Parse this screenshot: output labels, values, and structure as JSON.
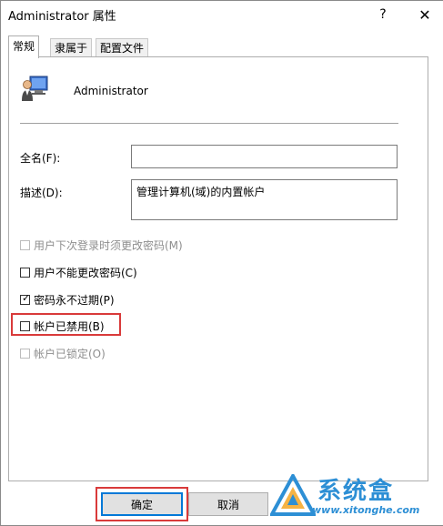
{
  "window": {
    "title": "Administrator 属性",
    "help_glyph": "?",
    "close_glyph": "✕"
  },
  "tabs": [
    {
      "label": "常规",
      "active": true
    },
    {
      "label": "隶属于",
      "active": false
    },
    {
      "label": "配置文件",
      "active": false
    }
  ],
  "user": {
    "name": "Administrator",
    "icon": "user-computer-icon"
  },
  "fields": {
    "fullname_label": "全名(F):",
    "fullname_value": "",
    "description_label": "描述(D):",
    "description_value": "管理计算机(域)的内置帐户"
  },
  "checkboxes": [
    {
      "label": "用户下次登录时须更改密码(M)",
      "checked": false,
      "disabled": true
    },
    {
      "label": "用户不能更改密码(C)",
      "checked": false,
      "disabled": false
    },
    {
      "label": "密码永不过期(P)",
      "checked": true,
      "disabled": false
    },
    {
      "label": "帐户已禁用(B)",
      "checked": false,
      "disabled": false,
      "highlighted": true
    },
    {
      "label": "帐户已锁定(O)",
      "checked": false,
      "disabled": true
    }
  ],
  "buttons": {
    "ok": "确定",
    "cancel": "取消"
  },
  "watermark": {
    "brand": "系统盒",
    "url": "www.xitonghe.com"
  },
  "colors": {
    "highlight": "#d93a3a",
    "focus": "#0078d7",
    "watermark": "#2d8fd5"
  }
}
